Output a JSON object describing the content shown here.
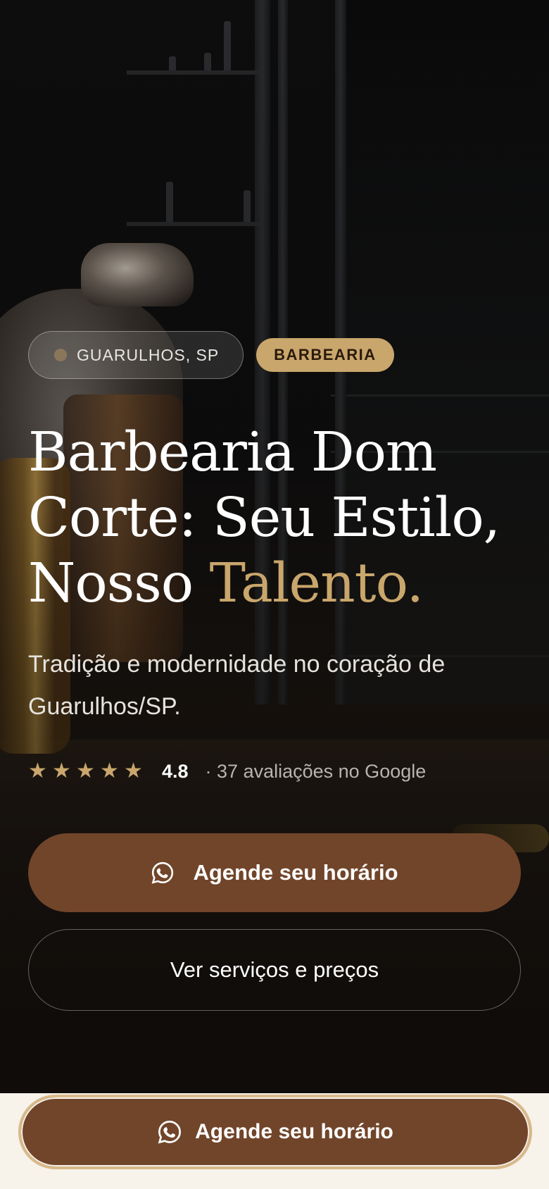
{
  "hero": {
    "location": "GUARULHOS, SP",
    "category": "BARBEARIA",
    "title_main": "Barbearia Dom Corte: Seu Estilo, Nosso ",
    "title_accent": "Talento.",
    "subtitle": "Tradição e modernidade no coração de Guarulhos/SP.",
    "rating": {
      "stars": 5,
      "value": "4.8",
      "text": "· 37 avaliações no Google"
    },
    "primary_button": {
      "label": "Agende seu horário",
      "icon": "whatsapp-icon"
    },
    "secondary_button": {
      "label": "Ver serviços e preços"
    }
  },
  "sticky_bar": {
    "button": {
      "label": "Agende seu horário",
      "icon": "whatsapp-icon"
    }
  },
  "colors": {
    "accent_gold": "#c9a66b",
    "button_brown": "#71452a",
    "bar_background": "#f7f2ea"
  }
}
